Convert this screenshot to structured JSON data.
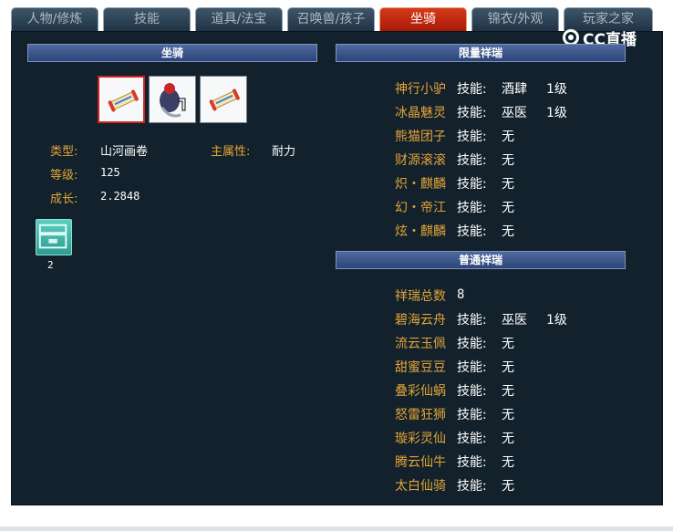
{
  "tabs": [
    {
      "label": "人物/修炼"
    },
    {
      "label": "技能"
    },
    {
      "label": "道具/法宝"
    },
    {
      "label": "召唤兽/孩子"
    },
    {
      "label": "坐骑",
      "active": true
    },
    {
      "label": "锦衣/外观"
    },
    {
      "label": "玩家之家"
    }
  ],
  "logo": {
    "text": "CC直播"
  },
  "mount": {
    "header": "坐骑",
    "slots": [
      {
        "icon": "scroll-icon",
        "selected": true
      },
      {
        "icon": "crane-mount-icon",
        "selected": false
      },
      {
        "icon": "scroll-icon",
        "selected": false
      }
    ],
    "type_label": "类型:",
    "type_value": "山河画卷",
    "attr_label": "主属性:",
    "attr_value": "耐力",
    "level_label": "等级:",
    "level_value": "125",
    "growth_label": "成长:",
    "growth_value": "2.2848",
    "item_icon": "chest-icon",
    "item_count": "2"
  },
  "limited": {
    "header": "限量祥瑞",
    "rows": [
      {
        "name": "神行小驴",
        "k": "技能:",
        "v": "酒肆",
        "lv": "1级"
      },
      {
        "name": "冰晶魅灵",
        "k": "技能:",
        "v": "巫医",
        "lv": "1级"
      },
      {
        "name": "熊猫团子",
        "k": "技能:",
        "v": "无",
        "lv": ""
      },
      {
        "name": "财源滚滚",
        "k": "技能:",
        "v": "无",
        "lv": ""
      },
      {
        "name": "炽・麒麟",
        "k": "技能:",
        "v": "无",
        "lv": ""
      },
      {
        "name": "幻・帝江",
        "k": "技能:",
        "v": "无",
        "lv": ""
      },
      {
        "name": "炫・麒麟",
        "k": "技能:",
        "v": "无",
        "lv": ""
      }
    ]
  },
  "normal": {
    "header": "普通祥瑞",
    "total_label": "祥瑞总数",
    "total_value": "8",
    "rows": [
      {
        "name": "碧海云舟",
        "k": "技能:",
        "v": "巫医",
        "lv": "1级"
      },
      {
        "name": "流云玉佩",
        "k": "技能:",
        "v": "无",
        "lv": ""
      },
      {
        "name": "甜蜜豆豆",
        "k": "技能:",
        "v": "无",
        "lv": ""
      },
      {
        "name": "叠彩仙蜗",
        "k": "技能:",
        "v": "无",
        "lv": ""
      },
      {
        "name": "怒雷狂狮",
        "k": "技能:",
        "v": "无",
        "lv": ""
      },
      {
        "name": "璇彩灵仙",
        "k": "技能:",
        "v": "无",
        "lv": ""
      },
      {
        "name": "腾云仙牛",
        "k": "技能:",
        "v": "无",
        "lv": ""
      },
      {
        "name": "太白仙骑",
        "k": "技能:",
        "v": "无",
        "lv": ""
      }
    ]
  }
}
